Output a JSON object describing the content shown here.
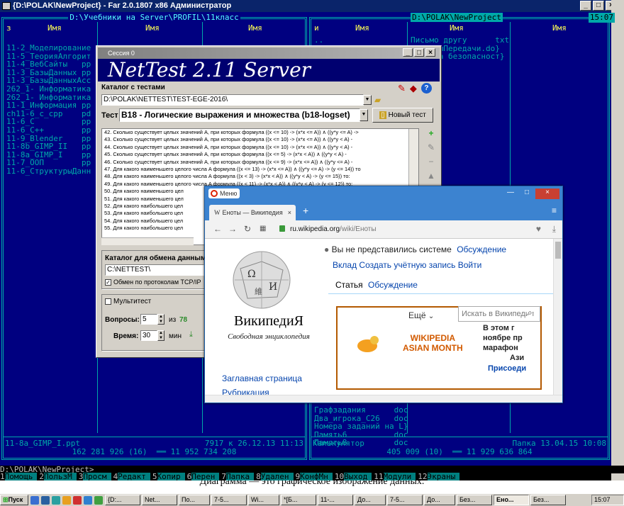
{
  "far": {
    "title": "{D:\\POLAK\\NewProject} - Far 2.0.1807 x86 Администратор",
    "left_path": "D:\\Учебники на Server\\PROFIL\\11класс",
    "right_path": "D:\\POLAK\\NewProject",
    "clock": "15:07",
    "left_col_heads": [
      "з",
      "Имя",
      "Имя",
      "Имя"
    ],
    "right_col_heads": [
      "и",
      "Имя",
      "Имя",
      "Имя"
    ],
    "left_files": "11-2_Моделирование\n11-5_ТеорияАлгорит\n11-4_ВебСайты   pp\n11-3_БазыДанных pp\n11-3_БазыДанныхАсс\n262_1- Информатика\n262_1- Информатика\n11-1_Информация pp\nch11-6_c_cpp    pd\n11-6_C          pp\n11-6_C++        pp\n11-9_Blender    pp\n11-8b_GIMP_II   pp\n11-8a_GIMP_I    pp\n11-7_ООП        pp\n11-6_СтруктурыДанн",
    "right_files_top": "..\n6_игры",
    "right_files_col2": "Письмо другу      txt\nПримерыПередачи.do}\nправила безопасност}",
    "right_files_bottom": "Графзадания      doc\nДва_игрока_C26   doc\nНомера заданий на L}\nПамять6          doc\nПамять8          doc",
    "left_footer_file": "11-8a_GIMP_I.ppt",
    "left_footer_info": "7917 к 26.12.13 11:13",
    "left_footer_totals": "162 281 926 (16)  ══ 11 952 734 208",
    "right_footer_file": "Калькулятор",
    "right_footer_info": "Папка 13.04.15 10:08",
    "right_footer_totals": "405 009 (10)  ══ 11 929 636 864",
    "prompt": "D:\\POLAK\\NewProject>",
    "keys": [
      {
        "n": "1",
        "l": "Помощь"
      },
      {
        "n": "2",
        "l": "ПользМ"
      },
      {
        "n": "3",
        "l": "Просм"
      },
      {
        "n": "4",
        "l": "Редакт"
      },
      {
        "n": "5",
        "l": "Копир"
      },
      {
        "n": "6",
        "l": "Перен"
      },
      {
        "n": "7",
        "l": "Папка"
      },
      {
        "n": "8",
        "l": "Удален"
      },
      {
        "n": "9",
        "l": "КонфМн"
      },
      {
        "n": "10",
        "l": "Выход"
      },
      {
        "n": "11",
        "l": "Модули"
      },
      {
        "n": "12",
        "l": "Экраны"
      }
    ]
  },
  "doc_text": "Диаграмма — это графическое изображение данных.",
  "nettest": {
    "window_title": "Сессия 0",
    "banner": "NetTest 2.11 Server",
    "catalog_label": "Каталог с тестами",
    "catalog_path": "D:\\POLAK\\NETTEST\\TEST-EGE-2016\\",
    "test_label": "Тест",
    "test_name": "B18 - Логические выражения и множества (b18-logset)",
    "new_test": "Новый тест",
    "questions": [
      "42. Сколько существует целых значений A, при которых формула  ((x <= 10) -> (x*x <= A)) ∧ ((y*y <= A) ->",
      "43. Сколько существует целых значений A, при которых формула  ((x <= 10) -> (x*x <= A)) ∧ ((y*y < A) -",
      "44. Сколько существует целых значений A, при которых формула  ((x <= 10) -> (x*x <= A)) ∧ ((y*y < A) -",
      "45. Сколько существует целых значений A, при которых формула  ((x <= 5) -> (x*x < A)) ∧ ((y*y < A) -",
      "46. Сколько существует целых значений A, при которых формула  ((x <= 9) -> (x*x <= A)) ∧ ((y*y <= A) -",
      "47. Для какого наименьшего целого числа A формула  ((x <= 13) -> (x*x <= A)) ∧ ((y*y <= A) -> (y <= 14)) то",
      "48. Для какого наименьшего целого числа A формула  ((x < 3) -> (x*x < A)) ∧ ((y*y < A) -> (y <= 15)) то:",
      "49. Для какого наименьшего целого числа A формула  ((x < 11) -> (x*x < A)) ∧ ((y*y < A) -> (y <= 12)) то:",
      "50. Для какого наименьшего цел",
      "51. Для какого наименьшего цел",
      "52. Для какого наибольшего цел",
      "53. Для какого наибольшего цел",
      "54. Для какого наибольшего цел",
      "55. Для какого наибольшего цел"
    ],
    "exchange_label": "Каталог для обмена данным",
    "exchange_path": "C:\\NETTEST\\",
    "tcp_label": "Обмен по протоколам TCP/IP",
    "multitest_label": "Мультитест",
    "questions_label": "Вопросы:",
    "questions_value": "5",
    "questions_of": "из",
    "questions_total": "78",
    "time_label": "Время:",
    "time_value": "30",
    "time_unit": "мин"
  },
  "browser": {
    "app_label": "Меню",
    "tab_title": "Еноты — Википедия",
    "url_host": "ru.wikipedia.org",
    "url_path": "/wiki/Еноты",
    "not_logged": "Вы не представились системе",
    "discussion": "Обсуждение",
    "contrib": "Вклад",
    "create_account": "Создать учётную запись",
    "login": "Войти",
    "tab_article": "Статья",
    "tab_talk": "Обсуждение",
    "more": "Ещё",
    "search_placeholder": "Искать в Википедии",
    "wordmark": "ВикипедиЯ",
    "tagline": "Свободная энциклопедия",
    "main_page": "Заглавная страница",
    "rubrics": "Рубрикация",
    "banner_title_1": "WIKIPEDIA",
    "banner_title_2": "ASIAN MONTH",
    "banner_text": [
      "В этом г",
      "ноябре пр",
      "марафон",
      "Ази"
    ],
    "banner_link": "Присоеди"
  },
  "taskbar": {
    "start": "Пуск",
    "items": [
      "{D:...",
      "Net...",
      "По...",
      "7-5...",
      "Wi...",
      "*[Б...",
      "11-...",
      "До...",
      "7-5...",
      "До...",
      "Без...",
      "Ено...",
      "Без..."
    ],
    "clock": "15:07"
  }
}
